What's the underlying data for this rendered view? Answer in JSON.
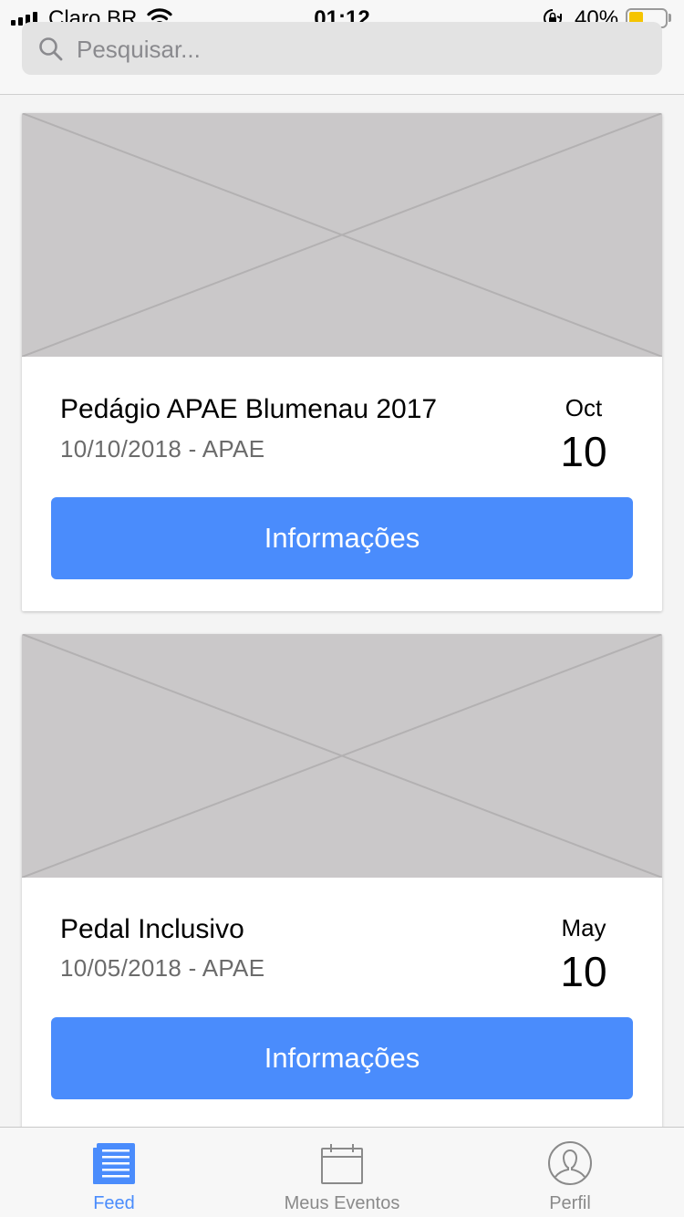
{
  "status_bar": {
    "carrier": "Claro BR",
    "time": "01:12",
    "battery_percent": "40%",
    "battery_level": 0.4,
    "battery_color": "#f5c400"
  },
  "search": {
    "placeholder": "Pesquisar...",
    "icon": "search-icon"
  },
  "events": [
    {
      "title": "Pedágio APAE Blumenau 2017",
      "subtitle": "10/10/2018 - APAE",
      "month": "Oct",
      "day": "10",
      "button_label": "Informações",
      "image": "image-placeholder"
    },
    {
      "title": "Pedal Inclusivo",
      "subtitle": "10/05/2018 - APAE",
      "month": "May",
      "day": "10",
      "button_label": "Informações",
      "image": "image-placeholder"
    }
  ],
  "tabbar": {
    "tabs": [
      {
        "label": "Feed",
        "icon": "newspaper-icon",
        "active": true
      },
      {
        "label": "Meus Eventos",
        "icon": "calendar-icon",
        "active": false
      },
      {
        "label": "Perfil",
        "icon": "user-icon",
        "active": false
      }
    ],
    "active_color": "#4a8cfc",
    "inactive_color": "#8a8a8a"
  },
  "colors": {
    "accent": "#4a8cfc",
    "placeholder_image": "#cac8c9"
  }
}
